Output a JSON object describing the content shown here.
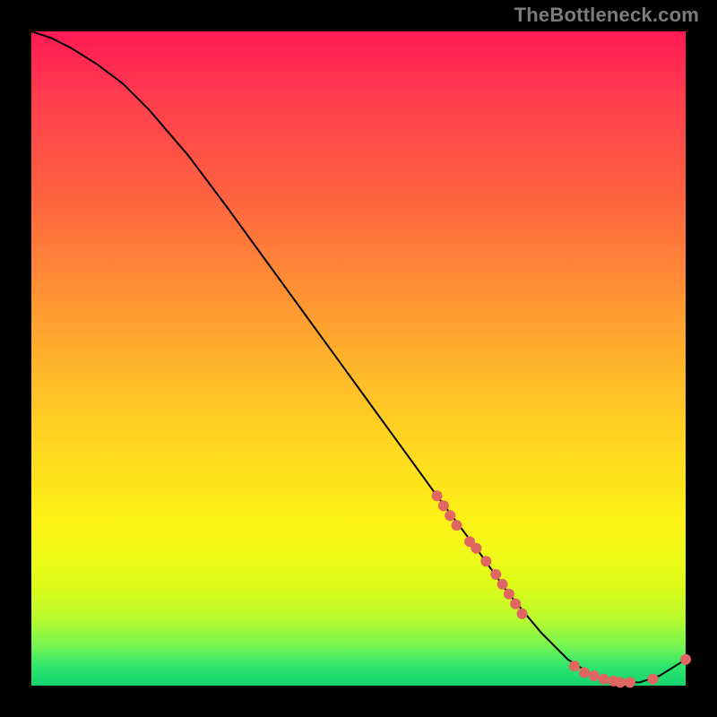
{
  "attribution": "TheBottleneck.com",
  "chart_data": {
    "type": "line",
    "title": "",
    "xlabel": "",
    "ylabel": "",
    "xlim": [
      0,
      100
    ],
    "ylim": [
      0,
      100
    ],
    "grid": false,
    "legend": false,
    "curve": {
      "x": [
        0,
        3,
        6,
        10,
        14,
        18,
        24,
        30,
        38,
        46,
        54,
        62,
        68,
        73,
        78,
        82,
        86,
        90,
        93,
        96,
        100
      ],
      "y": [
        100,
        99,
        97.5,
        95,
        92,
        88,
        81,
        73,
        62,
        51,
        40,
        29,
        21,
        14,
        8,
        4,
        1.5,
        0.5,
        0.5,
        1.5,
        4
      ]
    },
    "markers": [
      {
        "x": 62,
        "y": 29
      },
      {
        "x": 63,
        "y": 27.5
      },
      {
        "x": 64,
        "y": 26
      },
      {
        "x": 65,
        "y": 24.5
      },
      {
        "x": 67,
        "y": 22
      },
      {
        "x": 68,
        "y": 21
      },
      {
        "x": 69.5,
        "y": 19
      },
      {
        "x": 71,
        "y": 17
      },
      {
        "x": 72,
        "y": 15.5
      },
      {
        "x": 73,
        "y": 14
      },
      {
        "x": 74,
        "y": 12.5
      },
      {
        "x": 75,
        "y": 11
      },
      {
        "x": 83,
        "y": 3
      },
      {
        "x": 84.5,
        "y": 2
      },
      {
        "x": 86,
        "y": 1.5
      },
      {
        "x": 87.5,
        "y": 1
      },
      {
        "x": 89,
        "y": 0.7
      },
      {
        "x": 90,
        "y": 0.5
      },
      {
        "x": 91.5,
        "y": 0.5
      },
      {
        "x": 95,
        "y": 1
      },
      {
        "x": 100,
        "y": 4
      }
    ],
    "marker_color": "#e06761",
    "line_color": "#000000"
  }
}
